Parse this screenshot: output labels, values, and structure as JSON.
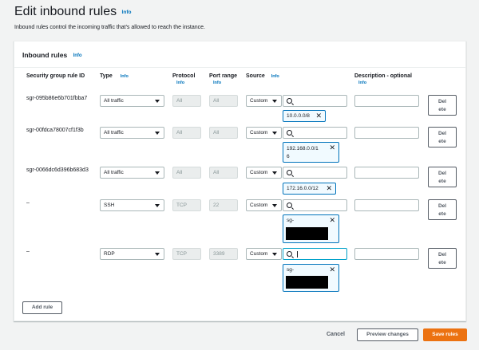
{
  "page": {
    "title": "Edit inbound rules",
    "title_info": "Info",
    "description": "Inbound rules control the incoming traffic that's allowed to reach the instance."
  },
  "panel": {
    "title": "Inbound rules",
    "title_info": "Info"
  },
  "columns": {
    "rule_id": "Security group rule ID",
    "type": "Type",
    "type_info": "Info",
    "protocol": "Protocol",
    "protocol_info": "Info",
    "port_range": "Port range",
    "port_range_info": "Info",
    "source": "Source",
    "source_info": "Info",
    "description": "Description - optional",
    "description_info": "Info"
  },
  "rules": [
    {
      "id": "sgr-095b86e6b701fbba7",
      "type": "All traffic",
      "protocol": "All",
      "port": "All",
      "source": "Custom",
      "token_line1": "10.0.0.0/8",
      "token_line2": "",
      "delete_line1": "Del",
      "delete_line2": "ete"
    },
    {
      "id": "sgr-00fdca78007cf1f3b",
      "type": "All traffic",
      "protocol": "All",
      "port": "All",
      "source": "Custom",
      "token_line1": "192.168.0.0/1",
      "token_line2": "6",
      "delete_line1": "Del",
      "delete_line2": "ete"
    },
    {
      "id": "sgr-0066dc6d396b683d3",
      "type": "All traffic",
      "protocol": "All",
      "port": "All",
      "source": "Custom",
      "token_line1": "172.16.0.0/12",
      "token_line2": "",
      "delete_line1": "Del",
      "delete_line2": "ete"
    },
    {
      "id": "–",
      "type": "SSH",
      "protocol": "TCP",
      "port": "22",
      "source": "Custom",
      "token_line1": "sg-",
      "token_line2": "",
      "delete_line1": "Del",
      "delete_line2": "ete"
    },
    {
      "id": "–",
      "type": "RDP",
      "protocol": "TCP",
      "port": "3389",
      "source": "Custom",
      "token_line1": "sg-",
      "token_line2": "",
      "delete_line1": "Del",
      "delete_line2": "ete"
    }
  ],
  "buttons": {
    "add_rule": "Add rule",
    "cancel": "Cancel",
    "preview": "Preview changes",
    "save": "Save rules"
  },
  "colors": {
    "accent": "#ec7211",
    "link": "#0073bb",
    "token_border": "#0073bb"
  },
  "icons": [
    "search-icon",
    "close-icon",
    "caret-down-icon"
  ]
}
